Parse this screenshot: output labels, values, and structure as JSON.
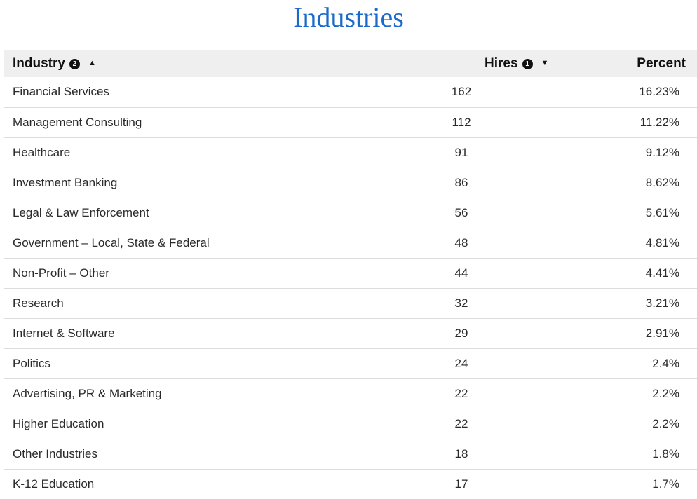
{
  "page": {
    "title": "Industries"
  },
  "table": {
    "headers": {
      "industry": "Industry",
      "industry_sort_priority": "2",
      "hires": "Hires",
      "hires_sort_priority": "1",
      "percent": "Percent"
    },
    "sort": {
      "industry_direction": "ascending",
      "hires_direction": "descending"
    },
    "rows": [
      {
        "industry": "Financial Services",
        "hires": "162",
        "percent": "16.23%"
      },
      {
        "industry": "Management Consulting",
        "hires": "112",
        "percent": "11.22%"
      },
      {
        "industry": "Healthcare",
        "hires": "91",
        "percent": "9.12%"
      },
      {
        "industry": "Investment Banking",
        "hires": "86",
        "percent": "8.62%"
      },
      {
        "industry": "Legal & Law Enforcement",
        "hires": "56",
        "percent": "5.61%"
      },
      {
        "industry": "Government – Local, State & Federal",
        "hires": "48",
        "percent": "4.81%"
      },
      {
        "industry": "Non-Profit – Other",
        "hires": "44",
        "percent": "4.41%"
      },
      {
        "industry": "Research",
        "hires": "32",
        "percent": "3.21%"
      },
      {
        "industry": "Internet & Software",
        "hires": "29",
        "percent": "2.91%"
      },
      {
        "industry": "Politics",
        "hires": "24",
        "percent": "2.4%"
      },
      {
        "industry": "Advertising, PR & Marketing",
        "hires": "22",
        "percent": "2.2%"
      },
      {
        "industry": "Higher Education",
        "hires": "22",
        "percent": "2.2%"
      },
      {
        "industry": "Other Industries",
        "hires": "18",
        "percent": "1.8%"
      },
      {
        "industry": "K-12 Education",
        "hires": "17",
        "percent": "1.7%"
      }
    ]
  }
}
